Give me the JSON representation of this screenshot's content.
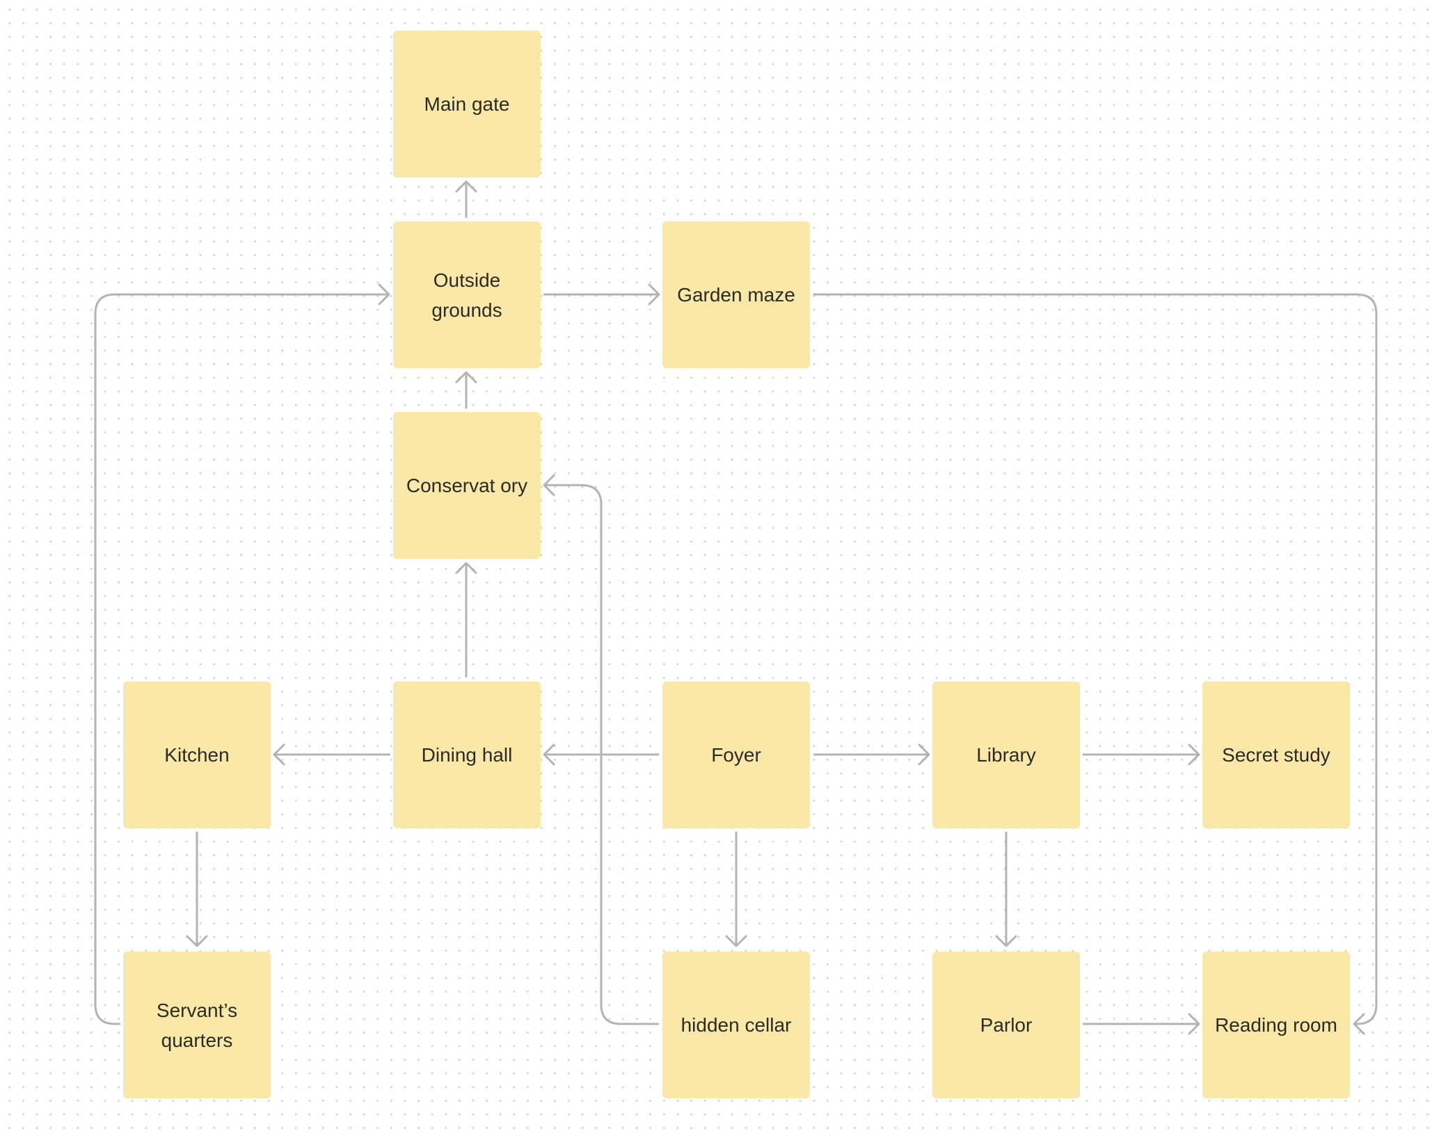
{
  "nodes": [
    {
      "id": "main-gate",
      "label": "Main gate"
    },
    {
      "id": "outside-grounds",
      "label": "Outside grounds"
    },
    {
      "id": "garden-maze",
      "label": "Garden maze"
    },
    {
      "id": "conservatory",
      "label": "Conservat ory"
    },
    {
      "id": "kitchen",
      "label": "Kitchen"
    },
    {
      "id": "dining-hall",
      "label": "Dining hall"
    },
    {
      "id": "foyer",
      "label": "Foyer"
    },
    {
      "id": "library",
      "label": "Library"
    },
    {
      "id": "secret-study",
      "label": "Secret study"
    },
    {
      "id": "servants-quarters",
      "label": "Servant’s quarters"
    },
    {
      "id": "hidden-cellar",
      "label": "hidden cellar"
    },
    {
      "id": "parlor",
      "label": "Parlor"
    },
    {
      "id": "reading-room",
      "label": "Reading room"
    }
  ],
  "edges": [
    {
      "from": "outside-grounds",
      "to": "main-gate"
    },
    {
      "from": "conservatory",
      "to": "outside-grounds"
    },
    {
      "from": "dining-hall",
      "to": "conservatory"
    },
    {
      "from": "outside-grounds",
      "to": "garden-maze"
    },
    {
      "from": "garden-maze",
      "to": "reading-room"
    },
    {
      "from": "servants-quarters",
      "to": "outside-grounds"
    },
    {
      "from": "hidden-cellar",
      "to": "conservatory"
    },
    {
      "from": "foyer",
      "to": "dining-hall"
    },
    {
      "from": "dining-hall",
      "to": "kitchen"
    },
    {
      "from": "foyer",
      "to": "library"
    },
    {
      "from": "library",
      "to": "secret-study"
    },
    {
      "from": "kitchen",
      "to": "servants-quarters"
    },
    {
      "from": "foyer",
      "to": "hidden-cellar"
    },
    {
      "from": "library",
      "to": "parlor"
    },
    {
      "from": "parlor",
      "to": "reading-room"
    }
  ],
  "colors": {
    "note": "#fae8a9",
    "connector": "#b3b3b3",
    "text": "#2b2b22"
  }
}
